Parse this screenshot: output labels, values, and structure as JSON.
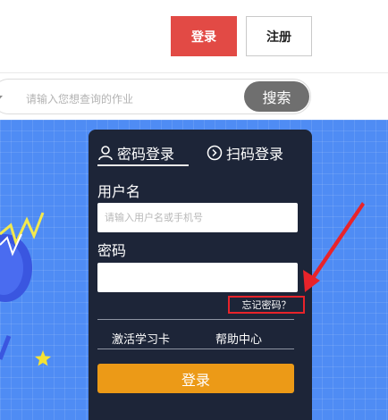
{
  "header": {
    "login_label": "登录",
    "register_label": "注册"
  },
  "search": {
    "placeholder": "请输入您想查询的作业",
    "button_label": "搜索"
  },
  "login_panel": {
    "tabs": [
      {
        "label": "密码登录",
        "icon": "user-icon",
        "active": true
      },
      {
        "label": "扫码登录",
        "icon": "chevron-circle-icon",
        "active": false
      }
    ],
    "username_label": "用户名",
    "username_placeholder": "请输入用户名或手机号",
    "password_label": "密码",
    "password_value": "",
    "forgot_label": "忘记密码？",
    "links": [
      "激活学习卡",
      "帮助中心"
    ],
    "submit_label": "登录"
  },
  "colors": {
    "primary_red": "#e24a45",
    "panel_bg": "#1d2538",
    "banner_blue": "#4f8cf4",
    "submit_orange": "#ec9a17",
    "highlight_red": "#e8232a"
  }
}
